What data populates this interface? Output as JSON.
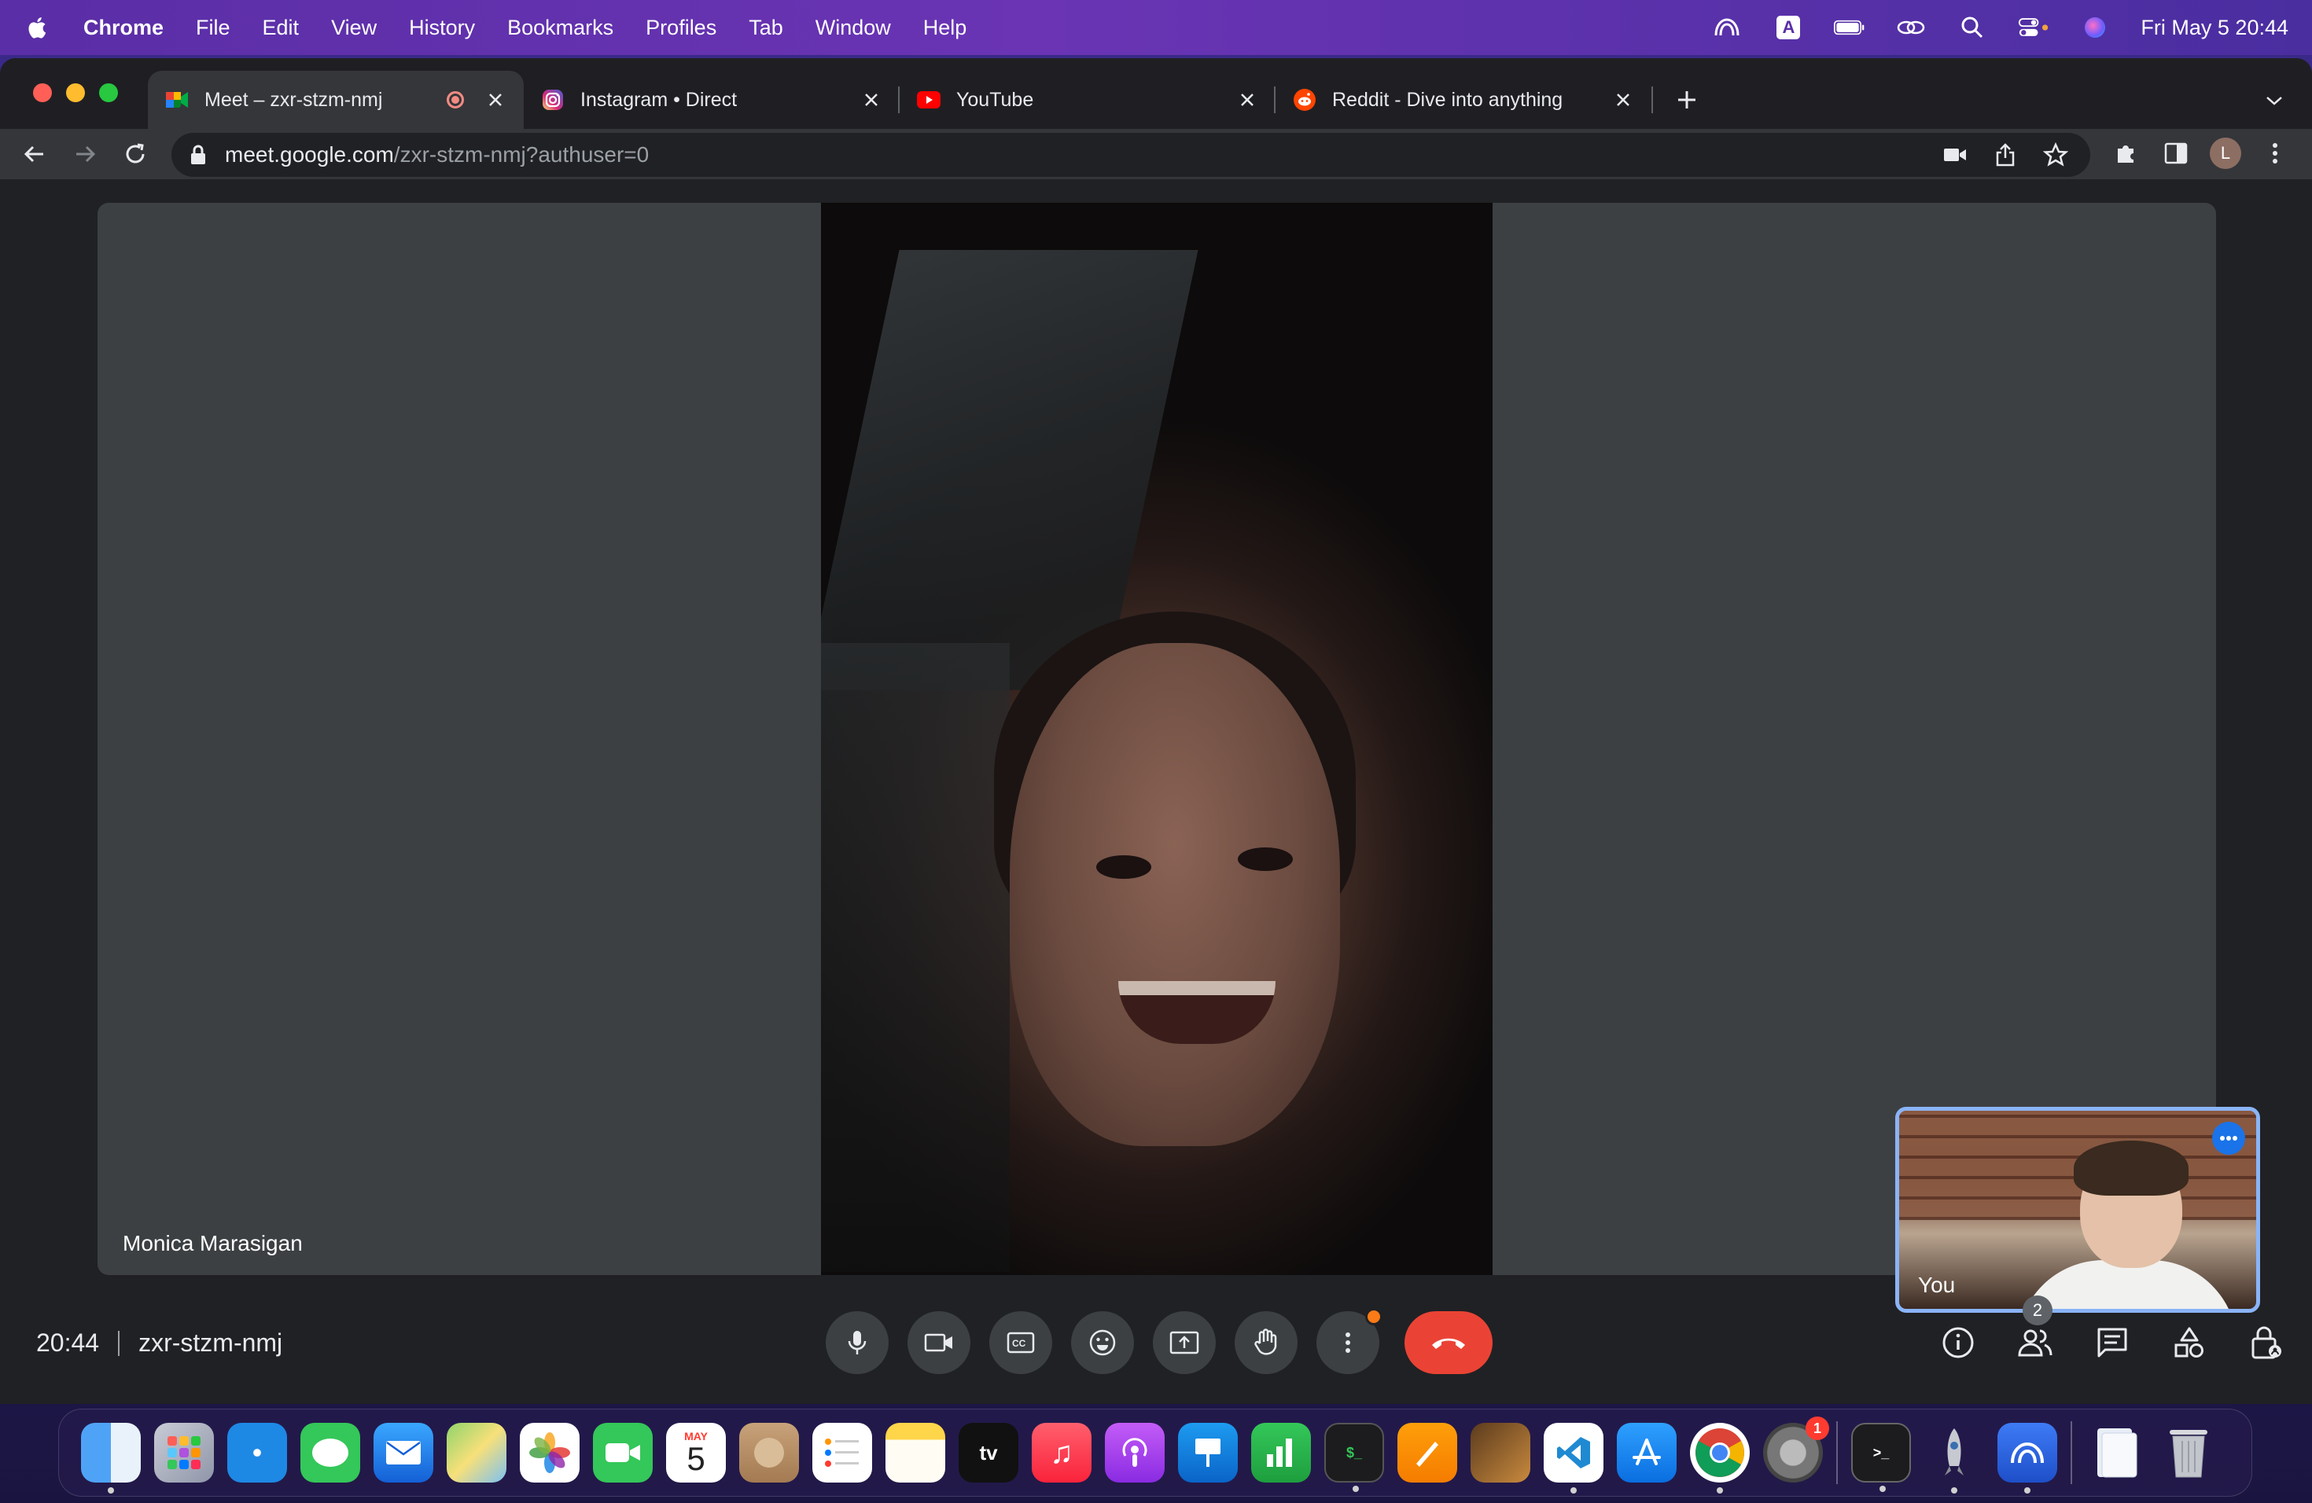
{
  "menubar": {
    "app_name": "Chrome",
    "menus": [
      "File",
      "Edit",
      "View",
      "History",
      "Bookmarks",
      "Profiles",
      "Tab",
      "Window",
      "Help"
    ],
    "status_icons": [
      "creative-cloud-icon",
      "input-source-icon",
      "battery-icon",
      "screen-mirroring-icon",
      "spotlight-icon",
      "control-center-icon",
      "siri-icon"
    ],
    "input_source_letter": "A",
    "clock": "Fri May 5  20:44"
  },
  "tabs": [
    {
      "title": "Meet – zxr-stzm-nmj",
      "icon": "google-meet-icon",
      "active": true,
      "recording": true
    },
    {
      "title": "Instagram • Direct",
      "icon": "instagram-icon",
      "active": false
    },
    {
      "title": "YouTube",
      "icon": "youtube-icon",
      "active": false
    },
    {
      "title": "Reddit - Dive into anything",
      "icon": "reddit-icon",
      "active": false
    }
  ],
  "address": {
    "host": "meet.google.com",
    "path": "/zxr-stzm-nmj?authuser=0"
  },
  "profile_initial": "L",
  "meet": {
    "participant_name": "Monica Marasigan",
    "self_label": "You",
    "time": "20:44",
    "meeting_code": "zxr-stzm-nmj",
    "people_count": "2",
    "controls": [
      "microphone-icon",
      "camera-icon",
      "captions-icon",
      "emoji-icon",
      "present-icon",
      "raise-hand-icon",
      "more-options-icon",
      "hang-up-icon"
    ],
    "right_tools": [
      "meeting-details-icon",
      "people-icon",
      "chat-icon",
      "activities-icon",
      "host-controls-icon"
    ]
  },
  "dock": {
    "calendar_month": "MAY",
    "calendar_day": "5",
    "tv_label": "tv",
    "settings_badge": "1",
    "apps": [
      "finder",
      "launchpad",
      "safari",
      "messages",
      "mail",
      "maps",
      "photos",
      "facetime",
      "calendar",
      "contacts",
      "reminders",
      "notes",
      "apple-tv",
      "music",
      "podcasts",
      "keynote",
      "numbers",
      "terminal",
      "pages",
      "garageband",
      "vscode",
      "app-store",
      "chrome",
      "system-settings",
      "terminal-2",
      "rocket",
      "creative-cloud",
      "documents",
      "trash"
    ]
  }
}
